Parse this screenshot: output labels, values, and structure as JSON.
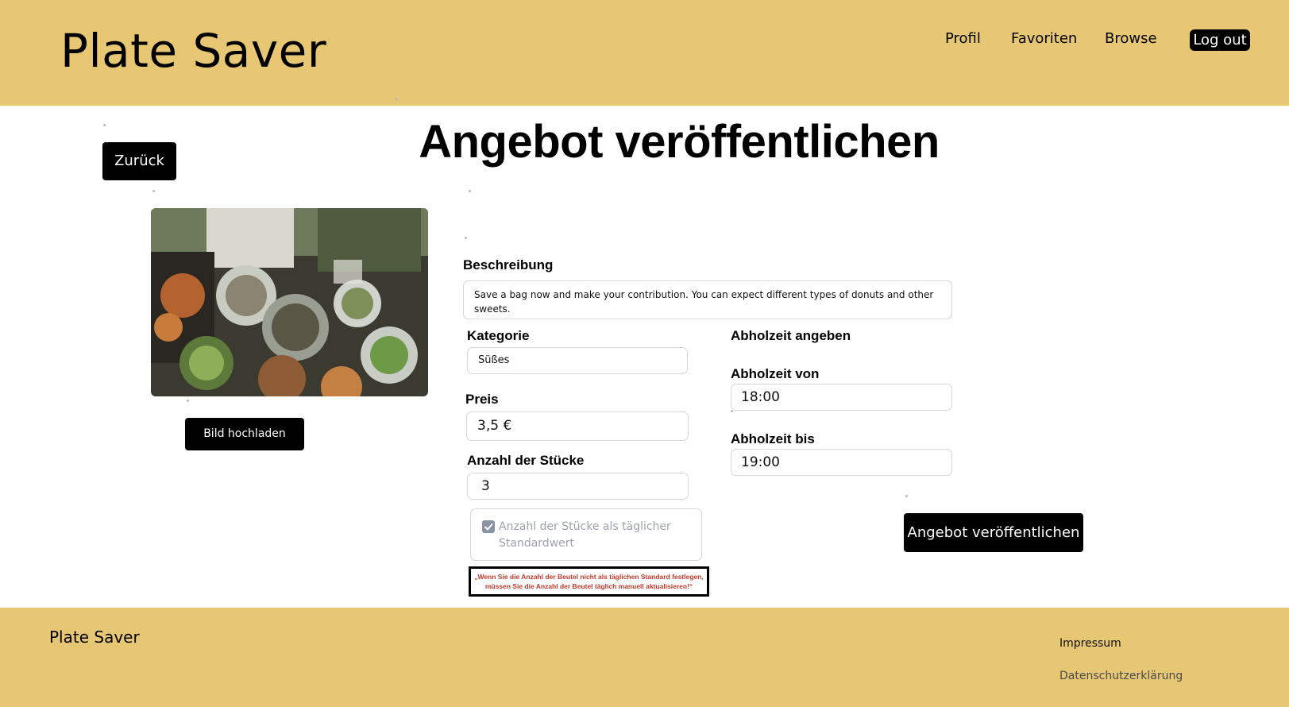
{
  "header": {
    "brand": "Plate Saver",
    "nav": [
      "Profil",
      "Favoriten",
      "Browse"
    ],
    "logout_label": "Log out"
  },
  "page": {
    "back_label": "Zurück",
    "title": "Angebot veröffentlichen"
  },
  "image": {
    "upload_label": "Bild hochladen"
  },
  "form": {
    "description_label": "Beschreibung",
    "description_value": "Save a bag now and make your contribution. You can expect different types of donuts and other sweets.",
    "category_label": "Kategorie",
    "category_value": "Süßes",
    "price_label": "Preis",
    "price_value": "3,5 €",
    "pieces_label": "Anzahl der Stücke",
    "pieces_value": "3",
    "checkbox_label": "Anzahl der Stücke als täglicher Standardwert",
    "checkbox_checked": true,
    "warning": "„Wenn Sie die Anzahl der Beutel nicht als täglichen Standard festlegen, müssen Sie die Anzahl der Beutel täglich manuell aktualisieren!“",
    "pickup_heading": "Abholzeit angeben",
    "pickup_from_label": "Abholzeit von",
    "pickup_from_value": "18:00",
    "pickup_to_label": "Abholzeit bis",
    "pickup_to_value": "19:00",
    "publish_label": "Angebot veröffentlichen"
  },
  "footer": {
    "brand": "Plate Saver",
    "links": [
      "Impressum",
      "Datenschutzerklärung"
    ]
  },
  "colors": {
    "accent": "#e7c674",
    "primary_button": "#000000",
    "warning_text": "#c0392b"
  }
}
